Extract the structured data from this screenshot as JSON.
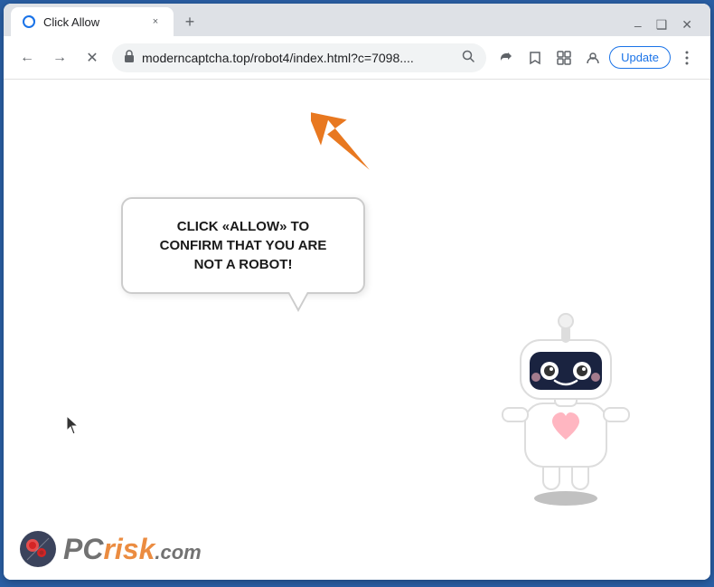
{
  "browser": {
    "tab": {
      "title": "Click Allow",
      "close_label": "×"
    },
    "new_tab_label": "+",
    "window_controls": {
      "minimize": "–",
      "maximize": "❑",
      "close": "✕"
    },
    "nav": {
      "back_label": "←",
      "forward_label": "→",
      "reload_label": "✕",
      "address": "moderncaptcha.top/robot4/index.html?c=7098....",
      "lock_icon": "🔒",
      "search_icon": "🔍",
      "share_icon": "⎙",
      "bookmark_icon": "☆",
      "extension_icon": "⬜",
      "profile_icon": "👤",
      "update_label": "Update",
      "menu_icon": "⋮"
    }
  },
  "page": {
    "bubble_text": "CLICK «ALLOW» TO CONFIRM THAT YOU ARE NOT A ROBOT!",
    "watermark": {
      "pc_text": "PC",
      "risk_text": "risk",
      "com_text": ".com"
    }
  }
}
